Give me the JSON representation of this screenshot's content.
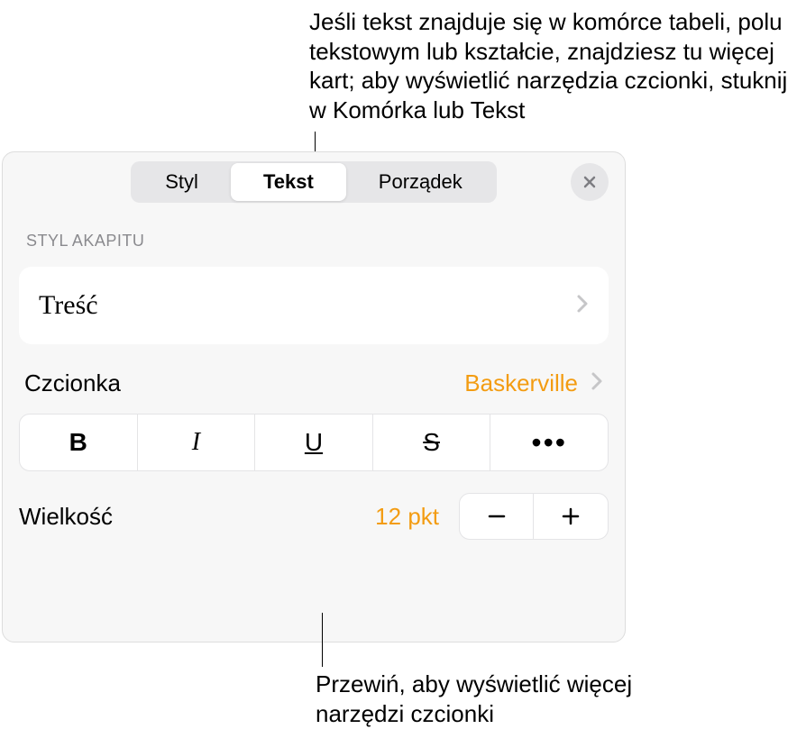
{
  "annotations": {
    "top": "Jeśli tekst znajduje się w komórce tabeli, polu tekstowym lub kształcie, znajdziesz tu więcej kart; aby wyświetlić narzędzia czcionki, stuknij w Komórka lub Tekst",
    "bottom": "Przewiń, aby wyświetlić więcej narzędzi czcionki"
  },
  "tabs": {
    "style": "Styl",
    "text": "Tekst",
    "arrange": "Porządek"
  },
  "sections": {
    "paragraph_style_label": "STYL AKAPITU",
    "paragraph_style_value": "Treść",
    "font_label": "Czcionka",
    "font_value": "Baskerville",
    "size_label": "Wielkość",
    "size_value": "12 pkt"
  },
  "style_buttons": {
    "bold": "B",
    "italic": "I",
    "underline": "U",
    "strike": "S",
    "more": "•••"
  }
}
